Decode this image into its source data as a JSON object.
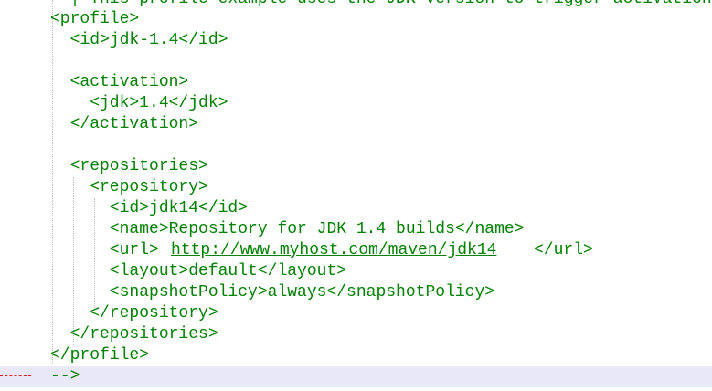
{
  "editor": {
    "lines": [
      "  | This profile example uses the JDK version to trigger activation",
      "<profile>",
      "  <id>jdk-1.4</id>",
      "",
      "  <activation>",
      "    <jdk>1.4</jdk>",
      "  </activation>",
      "",
      "  <repositories>",
      "    <repository>",
      "      <id>jdk14</id>",
      "      <name>Repository for JDK 1.4 builds</name>",
      "      <url>",
      "      <layout>default</layout>",
      "      <snapshotPolicy>always</snapshotPolicy>",
      "    </repository>",
      "  </repositories>",
      "</profile>",
      "-->"
    ],
    "url_link": "http://www.myhost.com/maven/jdk14",
    "url_close": "</url>"
  },
  "colors": {
    "text": "#008000",
    "current_line": "#e8e8f8",
    "change_marker": "#e02020",
    "indent_guide": "#c0c0c0"
  }
}
